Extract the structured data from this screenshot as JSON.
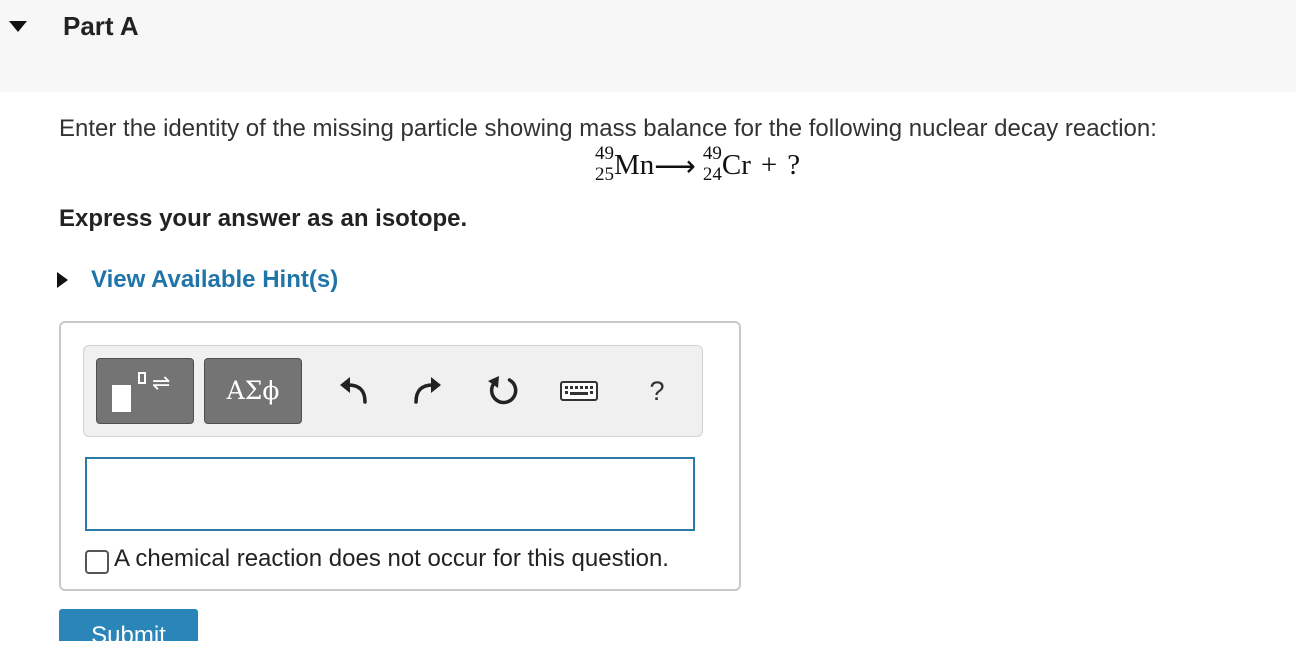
{
  "part": {
    "title": "Part A"
  },
  "question": {
    "prompt": "Enter the identity of the missing particle showing mass balance for the following nuclear decay reaction:",
    "equation": {
      "reactant": {
        "mass": "49",
        "atomic": "25",
        "symbol": "Mn"
      },
      "arrow": "⟶",
      "product": {
        "mass": "49",
        "atomic": "24",
        "symbol": "Cr"
      },
      "plus": "+",
      "unknown": "?"
    },
    "express": "Express your answer as an isotope."
  },
  "hints": {
    "label": "View Available Hint(s)"
  },
  "toolbar": {
    "greek_label": "ΑΣϕ",
    "help_label": "?"
  },
  "answer": {
    "value": "",
    "no_reaction_label": "A chemical reaction does not occur for this question.",
    "no_reaction_checked": false
  },
  "submit": {
    "label": "Submit"
  }
}
